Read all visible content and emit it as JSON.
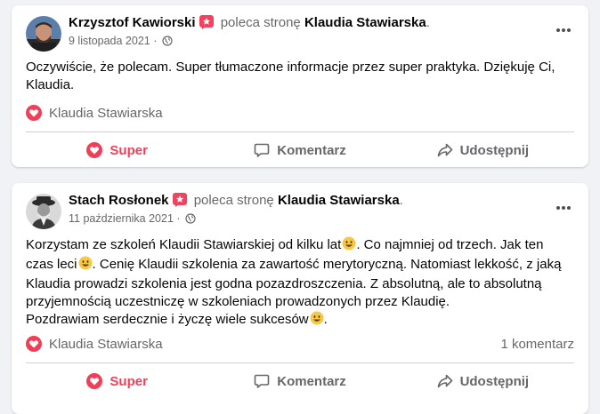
{
  "posts": [
    {
      "author": "Krzysztof Kawiorski",
      "verb": "poleca stronę",
      "page": "Klaudia Stawiarska",
      "date": "9 listopada 2021",
      "separator": "·",
      "body_lines": [
        "Oczywiście, że polecam. Super tłumaczone informacje przez super praktyka. Dziękuję Ci,",
        "Klaudia."
      ],
      "reaction_name": "Klaudia Stawiarska",
      "comment_count": "",
      "actions": {
        "super": "Super",
        "comment": "Komentarz",
        "share": "Udostępnij"
      }
    },
    {
      "author": "Stach Rosłonek",
      "verb": "poleca stronę",
      "page": "Klaudia Stawiarska",
      "date": "11 października 2021",
      "separator": "·",
      "body_lines": [
        "Korzystam ze szkoleń Klaudii Stawiarskiej od kilku lat",
        ". Co najmniej od trzech. Jak ten",
        "czas leci",
        ". Cenię Klaudii szkolenia za zawartość merytoryczną. Natomiast lekkość, z jaką",
        "Klaudia prowadzi szkolenia jest godna pozazdroszczenia. Z absolutną, ale to absolutną",
        "przyjemnością uczestniczę w szkoleniach prowadzonych przez Klaudię.",
        "Pozdrawiam serdecznie i życzę wiele sukcesów",
        "."
      ],
      "reaction_name": "Klaudia Stawiarska",
      "comment_count": "1 komentarz",
      "actions": {
        "super": "Super",
        "comment": "Komentarz",
        "share": "Udostępnij"
      }
    }
  ],
  "colors": {
    "super": "#f33e58",
    "muted": "#65676b",
    "badge": "#f3425f"
  },
  "icons": [
    "recommend-badge-icon",
    "globe-icon",
    "more-icon",
    "heart-icon",
    "comment-icon",
    "share-icon",
    "smile-emoji-icon"
  ]
}
